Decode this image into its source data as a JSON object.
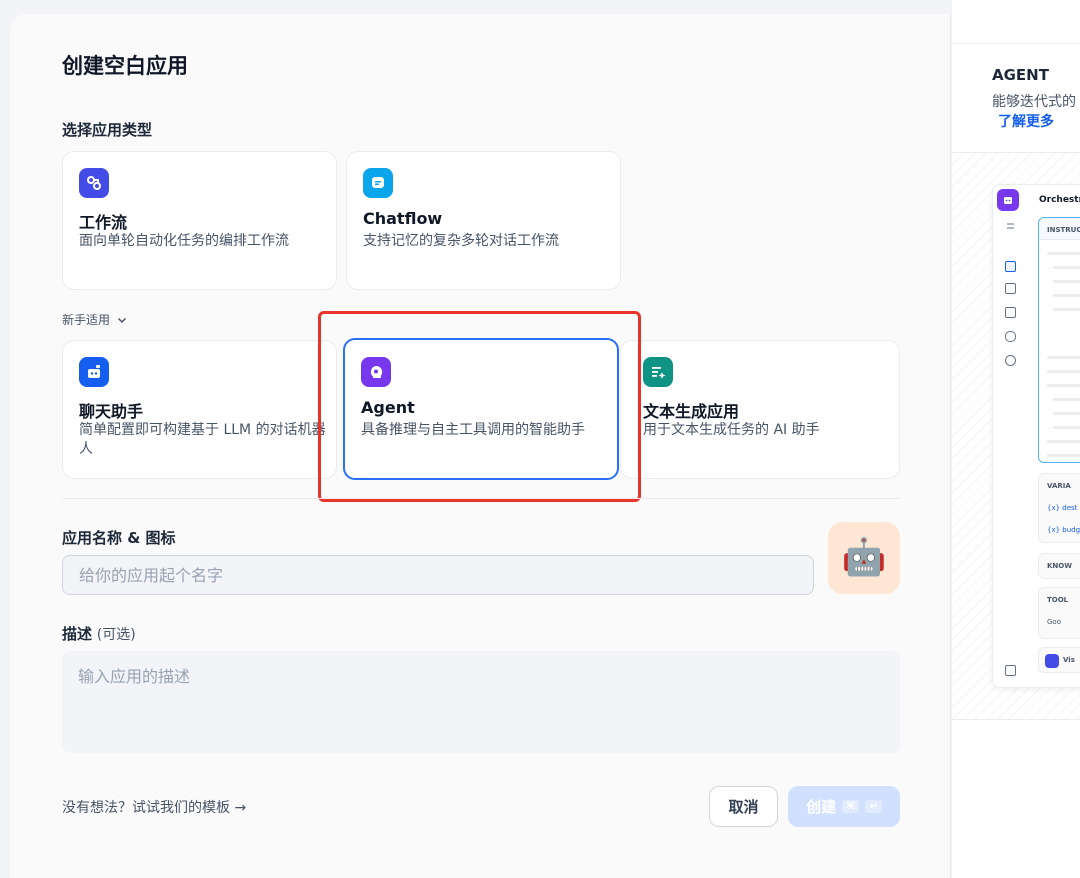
{
  "dialog": {
    "title": "创建空白应用",
    "type_section_label": "选择应用类型",
    "beginner_label": "新手适用"
  },
  "cards": {
    "workflow": {
      "name": "工作流",
      "desc": "面向单轮自动化任务的编排工作流",
      "icon": "workflow-icon"
    },
    "chatflow": {
      "name": "Chatflow",
      "desc": "支持记忆的复杂多轮对话工作流",
      "icon": "chatflow-icon"
    },
    "chatbot": {
      "name": "聊天助手",
      "desc": "简单配置即可构建基于 LLM 的对话机器人",
      "icon": "chatbot-icon"
    },
    "agent": {
      "name": "Agent",
      "desc": "具备推理与自主工具调用的智能助手",
      "icon": "agent-icon"
    },
    "textgen": {
      "name": "文本生成应用",
      "desc": "用于文本生成任务的 AI 助手",
      "icon": "text-generation-icon"
    }
  },
  "form": {
    "name_label": "应用名称 & 图标",
    "name_placeholder": "给你的应用起个名字",
    "desc_label": "描述",
    "desc_optional": "(可选)",
    "desc_placeholder": "输入应用的描述",
    "avatar_emoji": "🤖"
  },
  "footer": {
    "template_link": "没有想法？试试我们的模板 →",
    "cancel": "取消",
    "create": "创建"
  },
  "preview": {
    "heading": "AGENT",
    "desc": "能够迭代式的",
    "learn_more": "了解更多",
    "mock_title": "Orchestr",
    "instruction": "INSTRUC",
    "variables": "VARIA",
    "var1": "{x} dest",
    "var2": "{x} budg",
    "knowledge": "KNOW",
    "tools": "TOOL",
    "tool1": "Goo",
    "vision": "Vis"
  },
  "colors": {
    "accent": "#155eef",
    "selected_border": "#2970ff",
    "highlight_box": "#e8342b"
  }
}
